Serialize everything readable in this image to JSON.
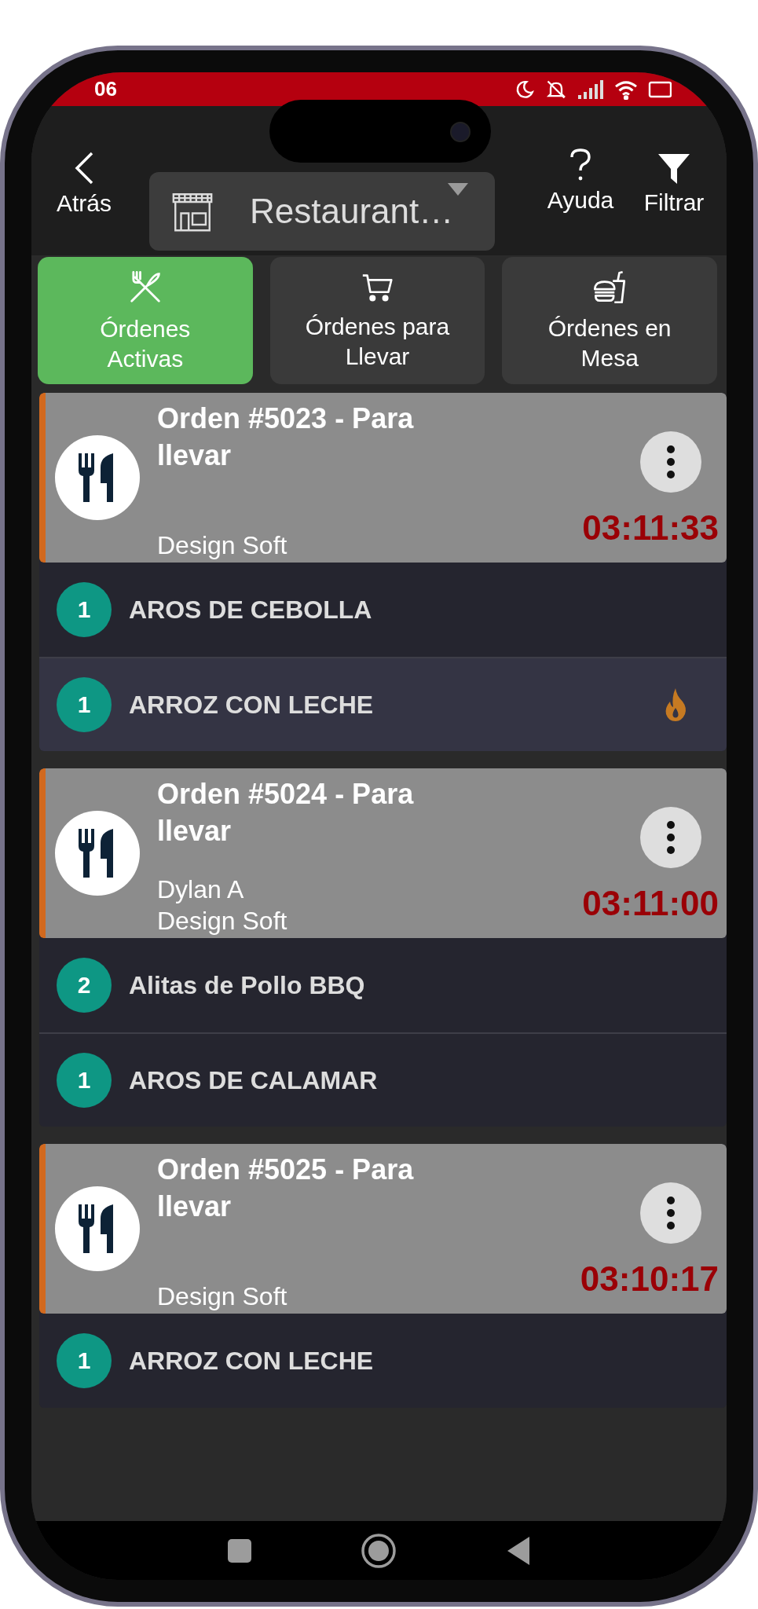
{
  "status_bar": {
    "time": "06"
  },
  "header": {
    "back_label": "Atrás",
    "restaurant": "Restaurant…",
    "help_label": "Ayuda",
    "filter_label": "Filtrar"
  },
  "tabs": [
    {
      "label": "Órdenes Activas",
      "kind": "utensils",
      "selected": true
    },
    {
      "label": "Órdenes para Llevar",
      "kind": "cart",
      "selected": false
    },
    {
      "label": "Órdenes en Mesa",
      "kind": "meal",
      "selected": false
    }
  ],
  "orders": [
    {
      "title": "Orden #5023 - Para llevar",
      "customer_lines": [
        "Design Soft"
      ],
      "timer": "03:11:33",
      "items": [
        {
          "qty": "1",
          "name": "AROS DE CEBOLLA",
          "urgent": false
        },
        {
          "qty": "1",
          "name": "ARROZ CON LECHE",
          "urgent": true
        }
      ]
    },
    {
      "title": "Orden #5024 - Para llevar",
      "customer_lines": [
        "Dylan A",
        "Design Soft"
      ],
      "timer": "03:11:00",
      "items": [
        {
          "qty": "2",
          "name": "Alitas de Pollo BBQ",
          "urgent": false
        },
        {
          "qty": "1",
          "name": "AROS DE CALAMAR",
          "urgent": false
        }
      ]
    },
    {
      "title": "Orden #5025 - Para llevar",
      "customer_lines": [
        "Design Soft"
      ],
      "timer": "03:10:17",
      "items": [
        {
          "qty": "1",
          "name": "ARROZ CON LECHE",
          "urgent": false
        }
      ]
    }
  ]
}
